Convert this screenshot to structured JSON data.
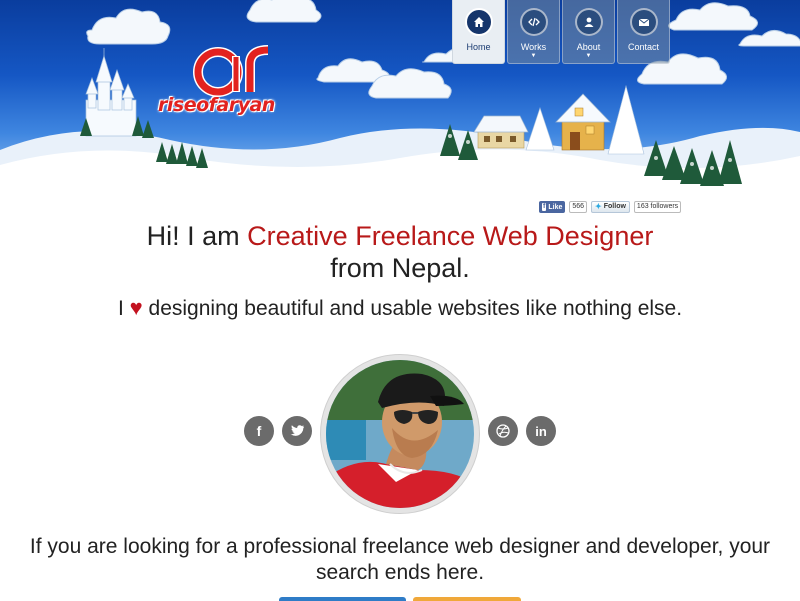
{
  "logo": {
    "mark": "ar",
    "text": "riseofaryan"
  },
  "nav": {
    "items": [
      {
        "label": "Home",
        "icon": "home-icon",
        "active": true,
        "dropdown": false
      },
      {
        "label": "Works",
        "icon": "code-icon",
        "active": false,
        "dropdown": true
      },
      {
        "label": "About",
        "icon": "user-icon",
        "active": false,
        "dropdown": true
      },
      {
        "label": "Contact",
        "icon": "envelope-icon",
        "active": false,
        "dropdown": false
      }
    ]
  },
  "social_counts": {
    "fb_label": "Like",
    "fb_count": "566",
    "tw_label": "Follow",
    "tw_count": "163 followers"
  },
  "hero": {
    "intro": "Hi! I am ",
    "highlight": "Creative Freelance Web Designer",
    "outro": "from Nepal.",
    "love_prefix": "I",
    "love_suffix": "designing beautiful and usable websites like nothing else."
  },
  "social_links": {
    "left": [
      "facebook-icon",
      "twitter-icon"
    ],
    "right": [
      "dribbble-icon",
      "linkedin-icon"
    ],
    "fb_glyph": "f",
    "in_glyph": "in"
  },
  "pitch": "If you are looking for a professional freelance web designer and developer, your search ends here.",
  "colors": {
    "accent": "#b81919",
    "nav_active": "#15356b",
    "social_bg": "#6b6b6b",
    "btn_blue": "#2f7cc7",
    "btn_orange": "#f0a83a"
  }
}
